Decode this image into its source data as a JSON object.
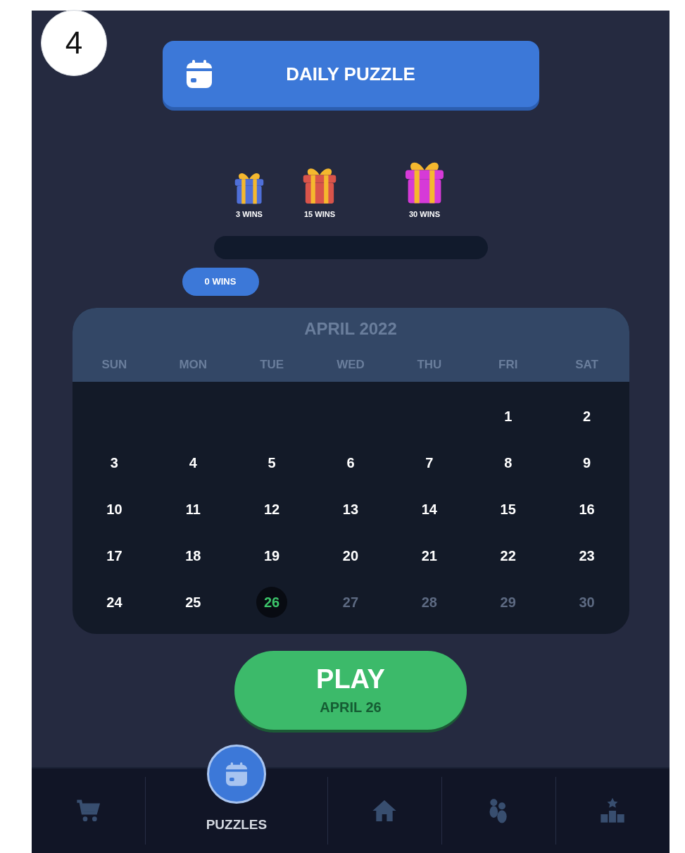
{
  "step_marker": "4",
  "header": {
    "title": "DAILY PUZZLE"
  },
  "rewards": [
    {
      "label": "3 WINS",
      "color": "#4f6fd8",
      "kind": "small"
    },
    {
      "label": "15 WINS",
      "color": "#d9544a",
      "kind": "medium"
    },
    {
      "label": "30 WINS",
      "color": "#d63ad8",
      "kind": "large"
    }
  ],
  "progress": {
    "level": 0,
    "tag": "0 WINS"
  },
  "calendar": {
    "title": "APRIL 2022",
    "weekdays": [
      "SUN",
      "MON",
      "TUE",
      "WED",
      "THU",
      "FRI",
      "SAT"
    ],
    "weeks": [
      [
        {
          "kind": "blank"
        },
        {
          "kind": "blank"
        },
        {
          "kind": "blank"
        },
        {
          "kind": "blank"
        },
        {
          "kind": "blank"
        },
        {
          "kind": "past",
          "label": "1"
        },
        {
          "kind": "past",
          "label": "2"
        }
      ],
      [
        {
          "kind": "past",
          "label": "3"
        },
        {
          "kind": "past",
          "label": "4"
        },
        {
          "kind": "past",
          "label": "5"
        },
        {
          "kind": "past",
          "label": "6"
        },
        {
          "kind": "past",
          "label": "7"
        },
        {
          "kind": "past",
          "label": "8"
        },
        {
          "kind": "past",
          "label": "9"
        }
      ],
      [
        {
          "kind": "past",
          "label": "10"
        },
        {
          "kind": "past",
          "label": "11"
        },
        {
          "kind": "past",
          "label": "12"
        },
        {
          "kind": "past",
          "label": "13"
        },
        {
          "kind": "past",
          "label": "14"
        },
        {
          "kind": "past",
          "label": "15"
        },
        {
          "kind": "past",
          "label": "16"
        }
      ],
      [
        {
          "kind": "past",
          "label": "17"
        },
        {
          "kind": "past",
          "label": "18"
        },
        {
          "kind": "past",
          "label": "19"
        },
        {
          "kind": "past",
          "label": "20"
        },
        {
          "kind": "past",
          "label": "21"
        },
        {
          "kind": "past",
          "label": "22"
        },
        {
          "kind": "past",
          "label": "23"
        }
      ],
      [
        {
          "kind": "past",
          "label": "24"
        },
        {
          "kind": "past",
          "label": "25"
        },
        {
          "kind": "today",
          "label": "26"
        },
        {
          "kind": "future",
          "label": "27"
        },
        {
          "kind": "future",
          "label": "28"
        },
        {
          "kind": "future",
          "label": "29"
        },
        {
          "kind": "future",
          "label": "30"
        }
      ]
    ]
  },
  "play_button": {
    "label": "PLAY",
    "date": "APRIL 26"
  },
  "nav": [
    {
      "kind": "cart",
      "selected": false
    },
    {
      "kind": "calendar",
      "label": "PUZZLES",
      "selected": true
    },
    {
      "kind": "home",
      "selected": false
    },
    {
      "kind": "people",
      "selected": false
    },
    {
      "kind": "podium",
      "selected": false
    }
  ]
}
